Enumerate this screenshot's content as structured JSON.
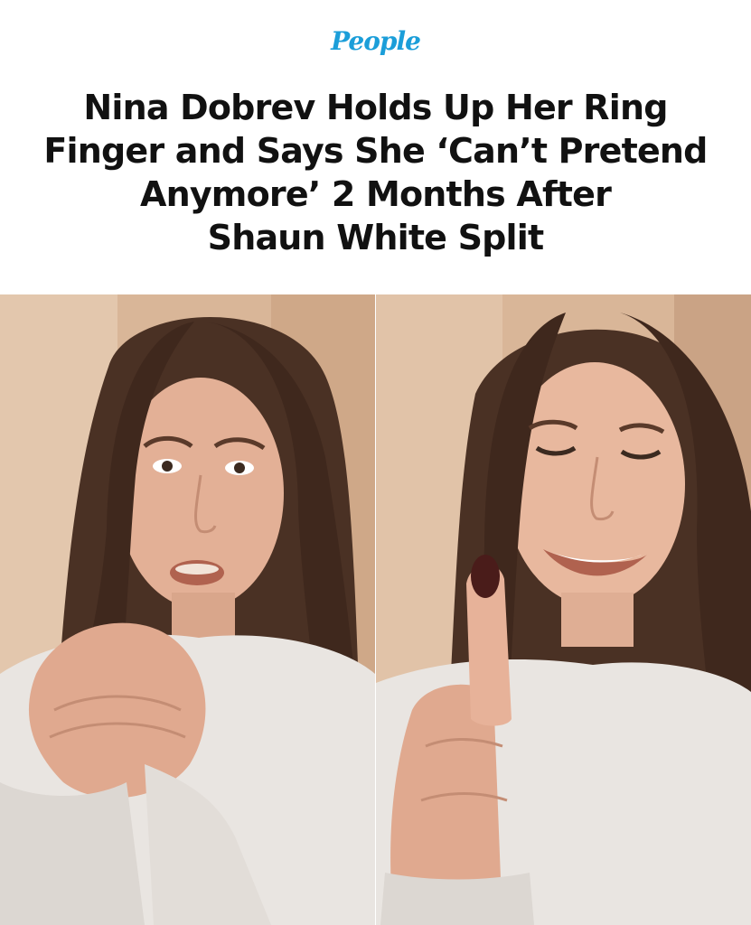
{
  "brand": {
    "logo_text": "People",
    "logo_color": "#1b9ed9"
  },
  "article": {
    "headline_lines": [
      "Nina Dobrev Holds Up Her Ring",
      "Finger and Says She ‘Can’t Pretend",
      "Anymore’ 2 Months After",
      "Shaun White Split"
    ]
  },
  "images": {
    "left_photo": "woman-clutching-hands-photo",
    "right_photo": "woman-holding-up-finger-photo"
  },
  "colors": {
    "wall": "#d9b698",
    "hair": "#4a3124",
    "skin": "#e3b096",
    "sweater": "#e9e5e1",
    "nail": "#4a1c1a"
  }
}
